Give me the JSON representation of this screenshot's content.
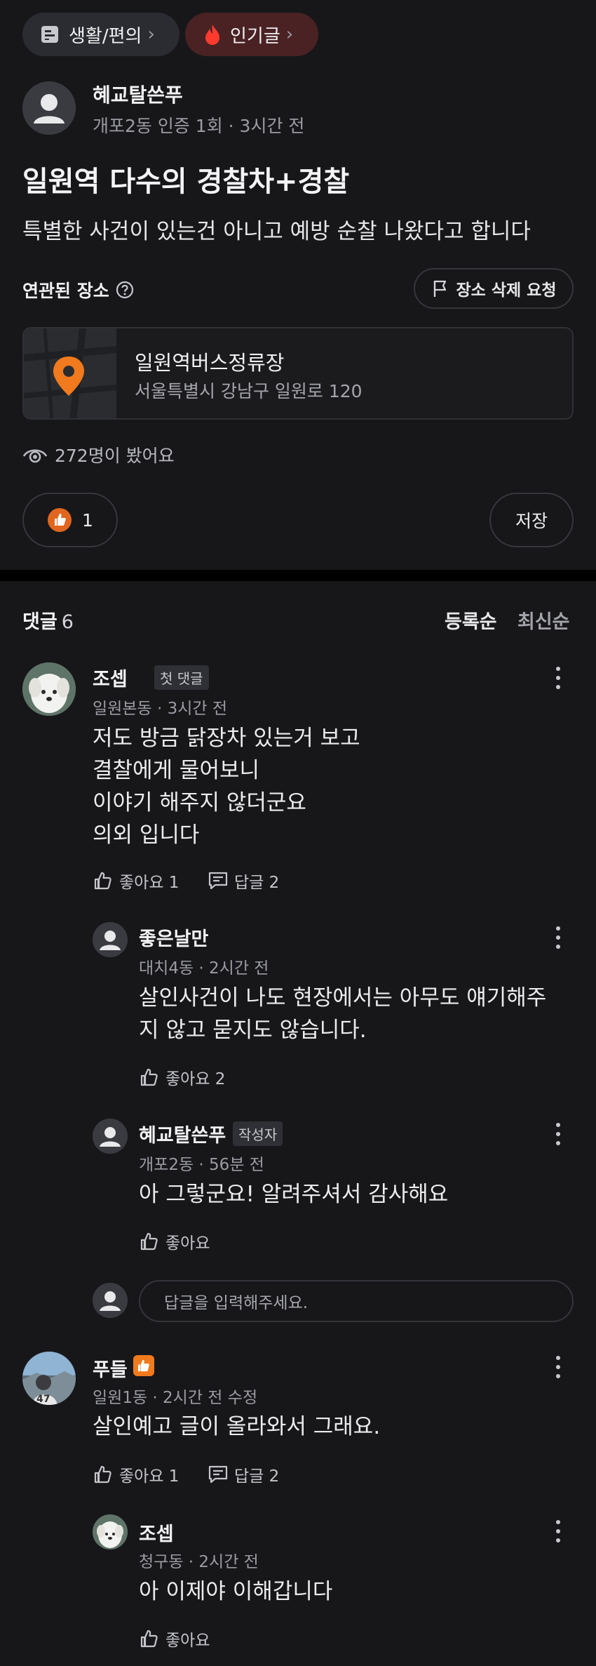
{
  "chips": {
    "category": "생활/편의",
    "popular": "인기글"
  },
  "post": {
    "author": "혜교탈쓴푸",
    "meta": "개포2동 인증 1회 · 3시간 전",
    "title": "일원역 다수의 경찰차+경찰",
    "body": "특별한 사건이 있는건 아니고 예방 순찰 나왔다고 합니다",
    "related_place_label": "연관된 장소",
    "delete_request": "장소 삭제 요청",
    "place_name": "일원역버스정류장",
    "place_address": "서울특별시 강남구 일원로 120",
    "views": "272명이 봤어요",
    "like_count": "1",
    "save_label": "저장"
  },
  "comments_header": {
    "title": "댓글",
    "count": "6",
    "sort_registered": "등록순",
    "sort_latest": "최신순"
  },
  "comments": [
    {
      "author": "조셉",
      "tag": "첫 댓글",
      "meta": "일원본동 · 3시간 전",
      "lines": [
        "저도 방금 닭장차 있는거 보고",
        "결찰에게 물어보니",
        "이야기 해주지 않더군요",
        "의외 입니다"
      ],
      "like": "좋아요 1",
      "reply": "답글 2"
    },
    {
      "author": "좋은날만",
      "meta": "대치4동 · 2시간 전",
      "lines": [
        "살인사건이 나도 현장에서는 아무도 얘기해주",
        "지 않고 묻지도 않습니다."
      ],
      "like": "좋아요 2"
    },
    {
      "author": "혜교탈쓴푸",
      "tag": "작성자",
      "meta": "개포2동 · 56분 전",
      "lines": [
        "아 그렇군요! 알려주셔서 감사해요"
      ],
      "like": "좋아요"
    },
    {
      "author": "푸들",
      "meta": "일원1동 · 2시간 전 수정",
      "lines": [
        "살인예고 글이 올라와서 그래요."
      ],
      "like": "좋아요 1",
      "reply": "답글 2"
    },
    {
      "author": "조셉",
      "meta": "청구동 · 2시간 전",
      "lines": [
        "아 이제야 이해갑니다"
      ],
      "like": "좋아요"
    }
  ],
  "reply_input": {
    "placeholder": "답글을 입력해주세요."
  },
  "colors": {
    "background": "#17171a",
    "accent_orange": "#f07a1d",
    "popular_chip_bg": "#4a2224",
    "chip_bg": "#2b2c31"
  },
  "icons": {
    "category": "board-icon",
    "popular": "fire-icon",
    "place": "map-pin-icon",
    "views": "eye-icon",
    "like": "thumbs-up-icon",
    "reply": "comment-icon",
    "help": "question-circle-icon",
    "delete_request": "flag-icon",
    "more": "kebab-icon"
  }
}
